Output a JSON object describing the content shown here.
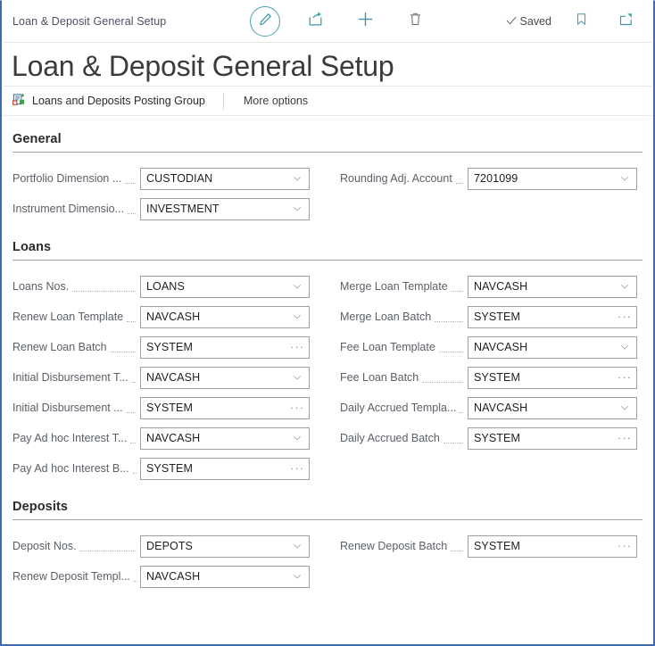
{
  "window": {
    "breadcrumb": "Loan & Deposit General Setup",
    "title": "Loan & Deposit General Setup",
    "border_color": "#3d6ab0",
    "accent_color": "#4aa3ab"
  },
  "toolbar": {
    "edit_label": "Edit",
    "share_label": "Share",
    "new_label": "New",
    "delete_label": "Delete",
    "saved_label": "Saved",
    "bookmark_label": "Bookmark",
    "open_full_label": "Open in new window",
    "icons": {
      "edit": "pencil-icon",
      "share": "share-icon",
      "new": "plus-icon",
      "delete": "trash-icon",
      "saved": "checkmark-icon",
      "bookmark": "bookmark-icon",
      "open_full": "open-in-new-window-icon"
    }
  },
  "ribbon": {
    "posting_group_label": "Loans and Deposits Posting Group",
    "more_options_label": "More options"
  },
  "sections": [
    {
      "title": "General",
      "left": [
        {
          "label": "Portfolio Dimension ...",
          "value": "CUSTODIAN",
          "control": "chevron"
        },
        {
          "label": "Instrument Dimensio...",
          "value": "INVESTMENT",
          "control": "chevron"
        }
      ],
      "right": [
        {
          "label": "Rounding Adj. Account",
          "value": "7201099",
          "control": "chevron"
        }
      ]
    },
    {
      "title": "Loans",
      "left": [
        {
          "label": "Loans Nos.",
          "value": "LOANS",
          "control": "chevron"
        },
        {
          "label": "Renew Loan Template",
          "value": "NAVCASH",
          "control": "chevron"
        },
        {
          "label": "Renew Loan Batch",
          "value": "SYSTEM",
          "control": "ellipsis"
        },
        {
          "label": "Initial Disbursement T...",
          "value": "NAVCASH",
          "control": "chevron"
        },
        {
          "label": "Initial Disbursement ...",
          "value": "SYSTEM",
          "control": "ellipsis"
        },
        {
          "label": "Pay Ad hoc Interest T...",
          "value": "NAVCASH",
          "control": "chevron"
        },
        {
          "label": "Pay Ad hoc Interest B...",
          "value": "SYSTEM",
          "control": "ellipsis"
        }
      ],
      "right": [
        {
          "label": "Merge Loan Template",
          "value": "NAVCASH",
          "control": "chevron"
        },
        {
          "label": "Merge Loan Batch",
          "value": "SYSTEM",
          "control": "ellipsis"
        },
        {
          "label": "Fee Loan Template",
          "value": "NAVCASH",
          "control": "chevron"
        },
        {
          "label": "Fee Loan Batch",
          "value": "SYSTEM",
          "control": "ellipsis"
        },
        {
          "label": "Daily Accrued Templa...",
          "value": "NAVCASH",
          "control": "chevron"
        },
        {
          "label": "Daily Accrued Batch",
          "value": "SYSTEM",
          "control": "ellipsis"
        }
      ]
    },
    {
      "title": "Deposits",
      "left": [
        {
          "label": "Deposit Nos.",
          "value": "DEPOTS",
          "control": "chevron"
        },
        {
          "label": "Renew Deposit Templ...",
          "value": "NAVCASH",
          "control": "chevron"
        }
      ],
      "right": [
        {
          "label": "Renew Deposit Batch",
          "value": "SYSTEM",
          "control": "ellipsis"
        }
      ]
    }
  ]
}
